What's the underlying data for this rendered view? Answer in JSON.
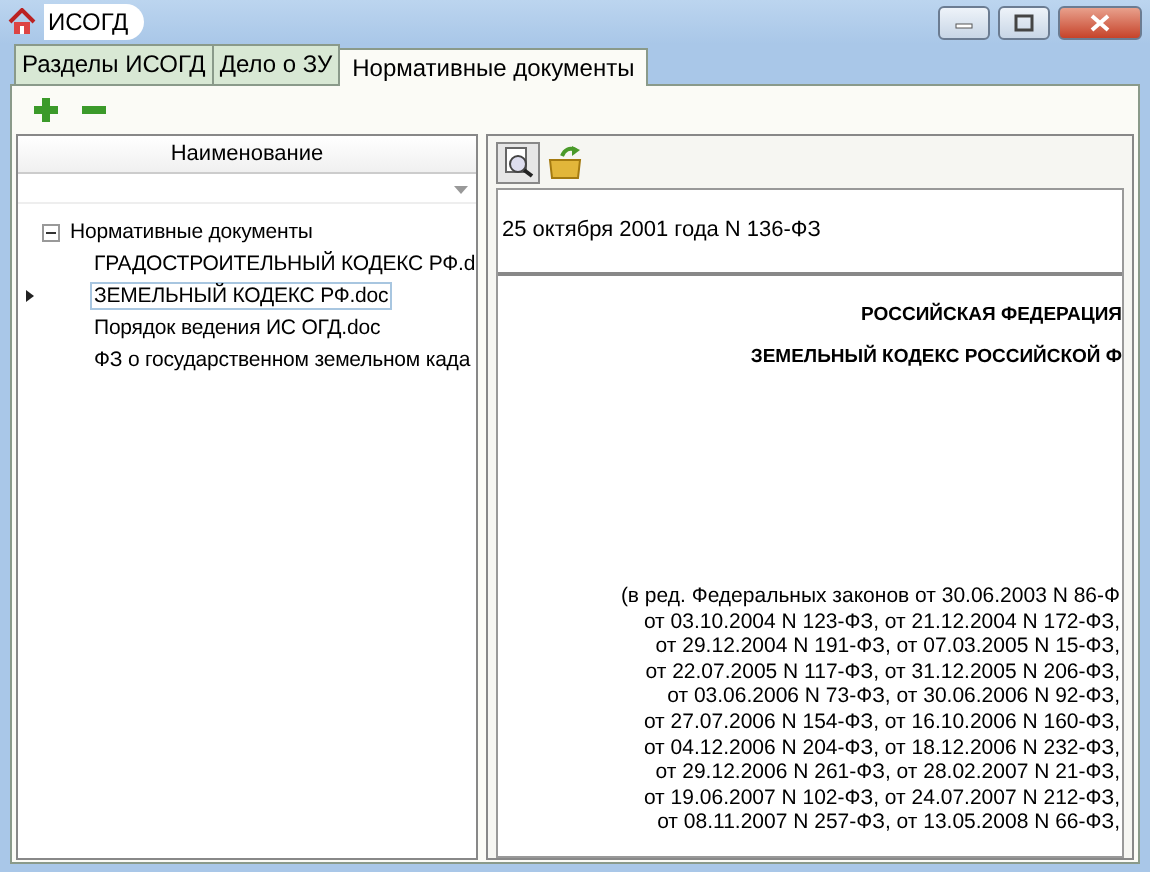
{
  "window": {
    "title": "ИСОГД"
  },
  "tabs": [
    {
      "label": "Разделы ИСОГД",
      "selected": false
    },
    {
      "label": "Дело о ЗУ",
      "selected": false
    },
    {
      "label": "Нормативные документы",
      "selected": true
    }
  ],
  "tree": {
    "column": "Наименование",
    "root": {
      "label": "Нормативные документы",
      "expanded": true,
      "children": [
        {
          "label": "ГРАДОСТРОИТЕЛЬНЫЙ КОДЕКС РФ.d",
          "selected": false
        },
        {
          "label": "ЗЕМЕЛЬНЫЙ КОДЕКС РФ.doc",
          "selected": true
        },
        {
          "label": "Порядок ведения ИС ОГД.doc",
          "selected": false
        },
        {
          "label": "ФЗ о государственном земельном када",
          "selected": false
        }
      ]
    }
  },
  "document": {
    "header": "25 октября 2001 года N 136-ФЗ",
    "headings": [
      "РОССИЙСКАЯ ФЕДЕРАЦИЯ",
      "ЗЕМЕЛЬНЫЙ КОДЕКС РОССИЙСКОЙ Ф"
    ],
    "lines": [
      "(в ред. Федеральных законов от 30.06.2003 N 86-Ф",
      "от 03.10.2004 N 123-ФЗ, от 21.12.2004 N 172-ФЗ,",
      "от 29.12.2004 N 191-ФЗ, от 07.03.2005 N 15-ФЗ,",
      "от 22.07.2005 N 117-ФЗ, от 31.12.2005 N 206-ФЗ,",
      "от 03.06.2006 N 73-ФЗ, от 30.06.2006 N 92-ФЗ,",
      "от 27.07.2006 N 154-ФЗ, от 16.10.2006 N 160-ФЗ,",
      "от 04.12.2006 N 204-ФЗ, от 18.12.2006 N 232-ФЗ,",
      "от 29.12.2006 N 261-ФЗ, от 28.02.2007 N 21-ФЗ,",
      "от 19.06.2007 N 102-ФЗ, от 24.07.2007 N 212-ФЗ,",
      "от 08.11.2007 N 257-ФЗ, от 13.05.2008 N 66-ФЗ,"
    ]
  }
}
